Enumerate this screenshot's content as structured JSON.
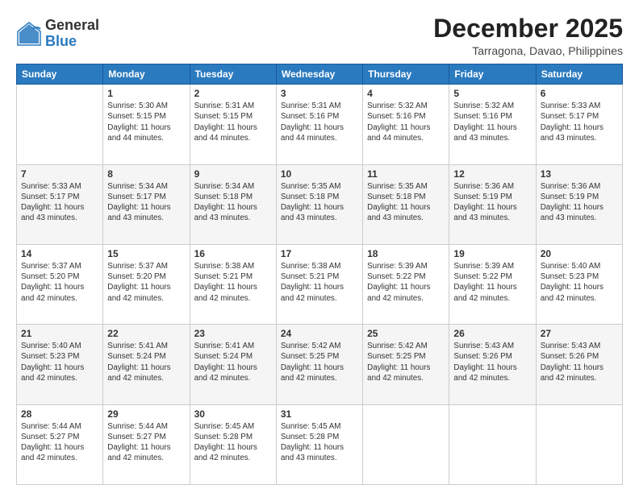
{
  "logo": {
    "general": "General",
    "blue": "Blue"
  },
  "header": {
    "month": "December 2025",
    "location": "Tarragona, Davao, Philippines"
  },
  "weekdays": [
    "Sunday",
    "Monday",
    "Tuesday",
    "Wednesday",
    "Thursday",
    "Friday",
    "Saturday"
  ],
  "weeks": [
    [
      {
        "day": "",
        "info": ""
      },
      {
        "day": "1",
        "info": "Sunrise: 5:30 AM\nSunset: 5:15 PM\nDaylight: 11 hours\nand 44 minutes."
      },
      {
        "day": "2",
        "info": "Sunrise: 5:31 AM\nSunset: 5:15 PM\nDaylight: 11 hours\nand 44 minutes."
      },
      {
        "day": "3",
        "info": "Sunrise: 5:31 AM\nSunset: 5:16 PM\nDaylight: 11 hours\nand 44 minutes."
      },
      {
        "day": "4",
        "info": "Sunrise: 5:32 AM\nSunset: 5:16 PM\nDaylight: 11 hours\nand 44 minutes."
      },
      {
        "day": "5",
        "info": "Sunrise: 5:32 AM\nSunset: 5:16 PM\nDaylight: 11 hours\nand 43 minutes."
      },
      {
        "day": "6",
        "info": "Sunrise: 5:33 AM\nSunset: 5:17 PM\nDaylight: 11 hours\nand 43 minutes."
      }
    ],
    [
      {
        "day": "7",
        "info": "Sunrise: 5:33 AM\nSunset: 5:17 PM\nDaylight: 11 hours\nand 43 minutes."
      },
      {
        "day": "8",
        "info": "Sunrise: 5:34 AM\nSunset: 5:17 PM\nDaylight: 11 hours\nand 43 minutes."
      },
      {
        "day": "9",
        "info": "Sunrise: 5:34 AM\nSunset: 5:18 PM\nDaylight: 11 hours\nand 43 minutes."
      },
      {
        "day": "10",
        "info": "Sunrise: 5:35 AM\nSunset: 5:18 PM\nDaylight: 11 hours\nand 43 minutes."
      },
      {
        "day": "11",
        "info": "Sunrise: 5:35 AM\nSunset: 5:18 PM\nDaylight: 11 hours\nand 43 minutes."
      },
      {
        "day": "12",
        "info": "Sunrise: 5:36 AM\nSunset: 5:19 PM\nDaylight: 11 hours\nand 43 minutes."
      },
      {
        "day": "13",
        "info": "Sunrise: 5:36 AM\nSunset: 5:19 PM\nDaylight: 11 hours\nand 43 minutes."
      }
    ],
    [
      {
        "day": "14",
        "info": "Sunrise: 5:37 AM\nSunset: 5:20 PM\nDaylight: 11 hours\nand 42 minutes."
      },
      {
        "day": "15",
        "info": "Sunrise: 5:37 AM\nSunset: 5:20 PM\nDaylight: 11 hours\nand 42 minutes."
      },
      {
        "day": "16",
        "info": "Sunrise: 5:38 AM\nSunset: 5:21 PM\nDaylight: 11 hours\nand 42 minutes."
      },
      {
        "day": "17",
        "info": "Sunrise: 5:38 AM\nSunset: 5:21 PM\nDaylight: 11 hours\nand 42 minutes."
      },
      {
        "day": "18",
        "info": "Sunrise: 5:39 AM\nSunset: 5:22 PM\nDaylight: 11 hours\nand 42 minutes."
      },
      {
        "day": "19",
        "info": "Sunrise: 5:39 AM\nSunset: 5:22 PM\nDaylight: 11 hours\nand 42 minutes."
      },
      {
        "day": "20",
        "info": "Sunrise: 5:40 AM\nSunset: 5:23 PM\nDaylight: 11 hours\nand 42 minutes."
      }
    ],
    [
      {
        "day": "21",
        "info": "Sunrise: 5:40 AM\nSunset: 5:23 PM\nDaylight: 11 hours\nand 42 minutes."
      },
      {
        "day": "22",
        "info": "Sunrise: 5:41 AM\nSunset: 5:24 PM\nDaylight: 11 hours\nand 42 minutes."
      },
      {
        "day": "23",
        "info": "Sunrise: 5:41 AM\nSunset: 5:24 PM\nDaylight: 11 hours\nand 42 minutes."
      },
      {
        "day": "24",
        "info": "Sunrise: 5:42 AM\nSunset: 5:25 PM\nDaylight: 11 hours\nand 42 minutes."
      },
      {
        "day": "25",
        "info": "Sunrise: 5:42 AM\nSunset: 5:25 PM\nDaylight: 11 hours\nand 42 minutes."
      },
      {
        "day": "26",
        "info": "Sunrise: 5:43 AM\nSunset: 5:26 PM\nDaylight: 11 hours\nand 42 minutes."
      },
      {
        "day": "27",
        "info": "Sunrise: 5:43 AM\nSunset: 5:26 PM\nDaylight: 11 hours\nand 42 minutes."
      }
    ],
    [
      {
        "day": "28",
        "info": "Sunrise: 5:44 AM\nSunset: 5:27 PM\nDaylight: 11 hours\nand 42 minutes."
      },
      {
        "day": "29",
        "info": "Sunrise: 5:44 AM\nSunset: 5:27 PM\nDaylight: 11 hours\nand 42 minutes."
      },
      {
        "day": "30",
        "info": "Sunrise: 5:45 AM\nSunset: 5:28 PM\nDaylight: 11 hours\nand 42 minutes."
      },
      {
        "day": "31",
        "info": "Sunrise: 5:45 AM\nSunset: 5:28 PM\nDaylight: 11 hours\nand 43 minutes."
      },
      {
        "day": "",
        "info": ""
      },
      {
        "day": "",
        "info": ""
      },
      {
        "day": "",
        "info": ""
      }
    ]
  ]
}
